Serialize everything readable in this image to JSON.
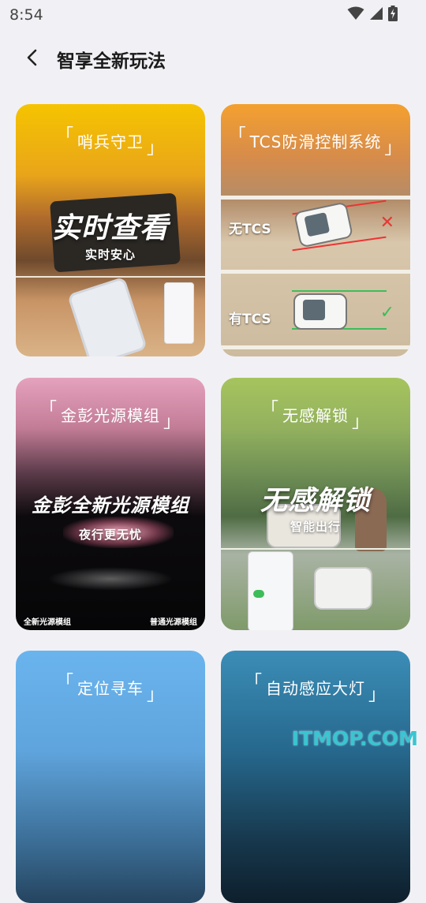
{
  "status_bar": {
    "time": "8:54"
  },
  "header": {
    "title": "智享全新玩法"
  },
  "cards": [
    {
      "title": "哨兵守卫",
      "headline": "实时查看",
      "subline": "实时安心"
    },
    {
      "title": "TCS防滑控制系统",
      "label_without": "无TCS",
      "label_with": "有TCS"
    },
    {
      "title": "金彭光源模组",
      "headline": "金彭全新光源模组",
      "subline": "夜行更无忧",
      "left_label": "全新光源模组",
      "right_label": "普通光源模组"
    },
    {
      "title": "无感解锁",
      "headline": "无感解锁",
      "subline": "智能出行"
    },
    {
      "title": "定位寻车"
    },
    {
      "title": "自动感应大灯"
    }
  ],
  "watermark": "ITMOP.COM",
  "colors": {
    "background": "#f1f1f5",
    "cross": "#e53935",
    "check": "#3dbd5a"
  },
  "icons": {
    "back": "chevron-left-icon",
    "wifi": "wifi-icon",
    "signal": "cell-signal-icon",
    "battery": "battery-charging-icon"
  }
}
